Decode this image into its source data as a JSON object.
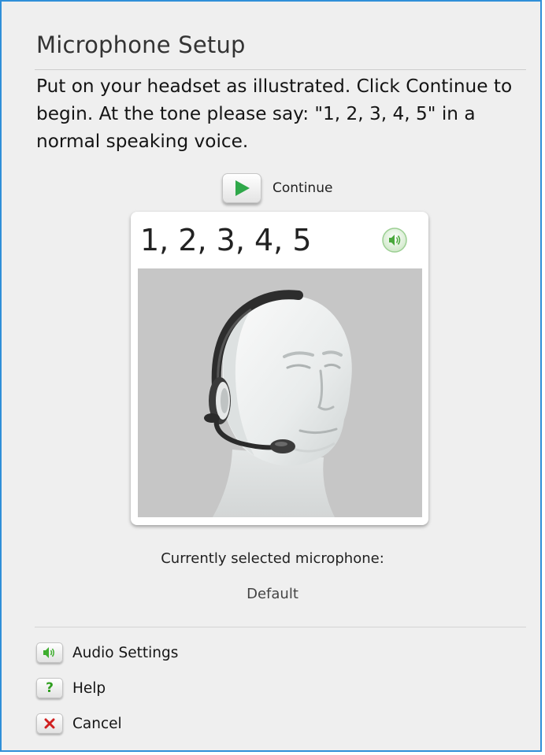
{
  "dialog": {
    "title": "Microphone Setup",
    "instructions": "Put on your headset as illustrated. Click Continue to begin. At the tone please say: \"1, 2, 3, 4, 5\" in a normal speaking voice.",
    "continue_label": "Continue",
    "continue_icon": "play-icon",
    "card": {
      "count_text": "1, 2, 3, 4, 5",
      "speaker_icon": "speaker-icon",
      "illustration": "headset-head-illustration"
    },
    "microphone": {
      "caption": "Currently selected microphone:",
      "value": "Default"
    },
    "links": [
      {
        "label": "Audio Settings",
        "icon": "speaker-icon"
      },
      {
        "label": "Help",
        "icon": "question-icon"
      },
      {
        "label": "Cancel",
        "icon": "close-icon"
      }
    ]
  },
  "colors": {
    "border": "#2f8fd8",
    "background": "#efefef",
    "accent_green": "#3fae2f",
    "help_green": "#2f9e1f",
    "cancel_red": "#d02020"
  }
}
